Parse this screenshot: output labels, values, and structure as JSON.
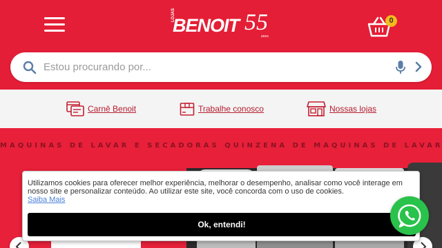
{
  "header": {
    "logo_tag": "LOJAS",
    "logo_brand": "BENOIT",
    "logo_years": "55",
    "logo_years_suffix": "anos",
    "cart_count": "0",
    "background_color": "#e41e36"
  },
  "search": {
    "placeholder": "Estou procurando por..."
  },
  "quick_links": [
    {
      "label": "Carnê Benoit",
      "icon": "credit-card-icon"
    },
    {
      "label": "Trabalhe conosco",
      "icon": "box-icon"
    },
    {
      "label": "Nossas lojas",
      "icon": "store-icon"
    }
  ],
  "banner": {
    "marquee_text": "MÁQUINAS DE LAVAR E SECADORAS  QUINZENA DE MÁQUINAS DE LAVAR E SECADORAS  QUINZENA"
  },
  "cookie": {
    "message": "Utilizamos cookies para oferecer melhor experiência, melhorar o desempenho, analisar como você interage em nosso site e personalizar conteúdo. Ao utilizar este site, você concorda com o uso de cookies.",
    "link_label": "Saiba Mais",
    "button_label": "Ok, entendi!"
  }
}
